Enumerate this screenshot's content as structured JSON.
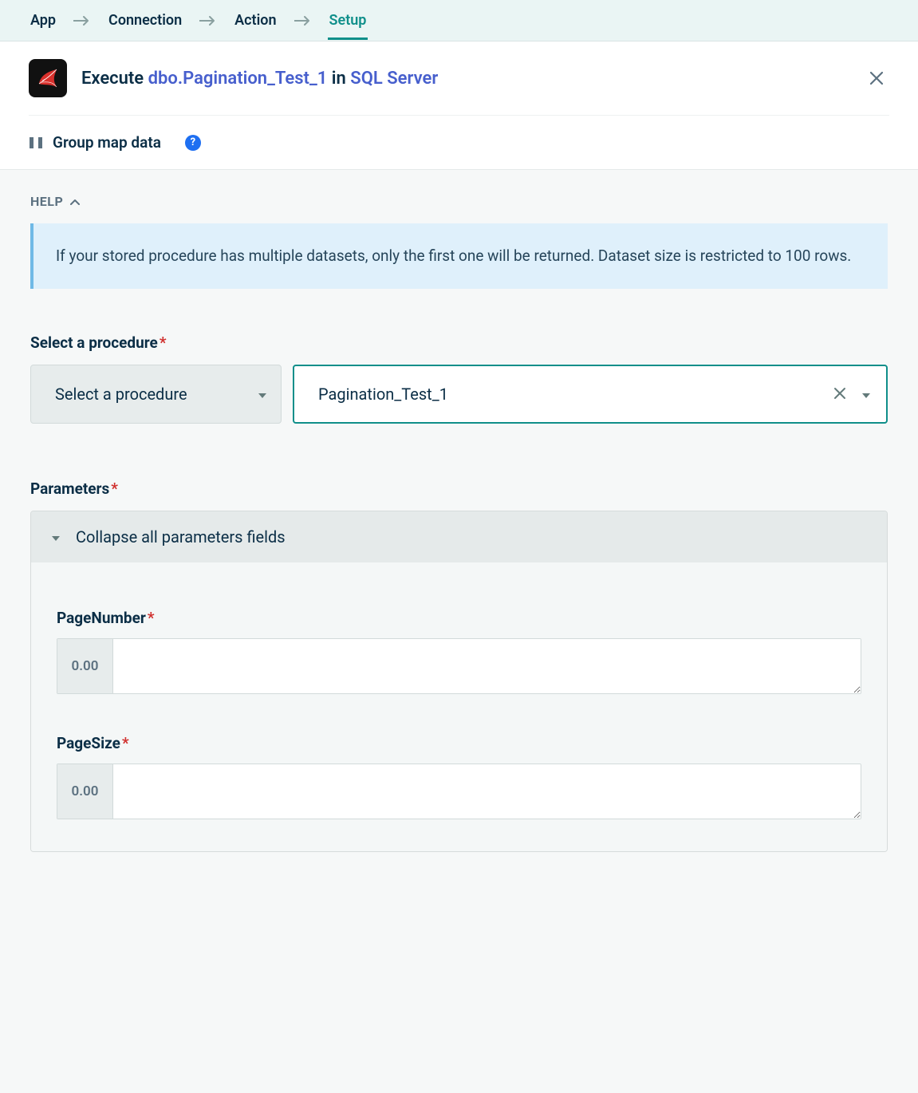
{
  "tabs": {
    "app": "App",
    "connection": "Connection",
    "action": "Action",
    "setup": "Setup",
    "active": "setup"
  },
  "header": {
    "exec_prefix": "Execute ",
    "procedure_link": "dbo.Pagination_Test_1",
    "in_text": " in ",
    "connector_link": "SQL Server",
    "group_map_label": "Group map data"
  },
  "help": {
    "toggle_label": "HELP",
    "text": "If your stored procedure has multiple datasets, only the first one will be returned. Dataset size is restricted to 100 rows."
  },
  "procedure": {
    "label": "Select a procedure",
    "dropdown_placeholder": "Select a procedure",
    "value": "Pagination_Test_1"
  },
  "parameters": {
    "label": "Parameters",
    "collapse_label": "Collapse all parameters fields",
    "fields": [
      {
        "name": "PageNumber",
        "prefix": "0.00",
        "value": ""
      },
      {
        "name": "PageSize",
        "prefix": "0.00",
        "value": ""
      }
    ]
  }
}
